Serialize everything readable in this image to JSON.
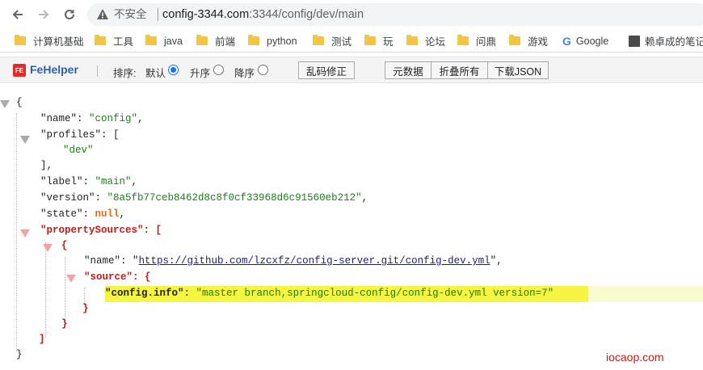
{
  "browser": {
    "insecure_label": "不安全",
    "url_host": "config-3344.com",
    "url_path": ":3344/config/dev/main"
  },
  "bookmarks": [
    {
      "label": "计算机基础",
      "icon": "folder-icon"
    },
    {
      "label": "工具",
      "icon": "folder-icon"
    },
    {
      "label": "java",
      "icon": "folder-icon"
    },
    {
      "label": "前端",
      "icon": "folder-icon"
    },
    {
      "label": "python",
      "icon": "folder-icon"
    },
    {
      "label": "测试",
      "icon": "folder-icon"
    },
    {
      "label": "玩",
      "icon": "folder-icon"
    },
    {
      "label": "论坛",
      "icon": "folder-icon"
    },
    {
      "label": "问鼎",
      "icon": "folder-icon"
    },
    {
      "label": "游戏",
      "icon": "folder-icon"
    },
    {
      "label": "Google",
      "icon": "google-icon"
    },
    {
      "label": "赖卓成的笔记",
      "icon": "image-icon"
    }
  ],
  "fehelper": {
    "title": "FeHelper",
    "logo": "FE",
    "sort_label": "排序:",
    "sort_options": [
      {
        "label": "默认",
        "checked": true
      },
      {
        "label": "升序",
        "checked": false
      },
      {
        "label": "降序",
        "checked": false
      }
    ],
    "fix_encoding": "乱码修正",
    "buttons": [
      "元数据",
      "折叠所有",
      "下载JSON"
    ]
  },
  "json": {
    "open_brace": "{",
    "close_brace": "}",
    "name_key": "\"name\"",
    "name_val": "\"config\"",
    "profiles_key": "\"profiles\"",
    "profiles_item": "\"dev\"",
    "label_key": "\"label\"",
    "label_val": "\"main\"",
    "version_key": "\"version\"",
    "version_val": "\"8a5fb77ceb8462d8c8f0cf33968d6c91560eb212\"",
    "state_key": "\"state\"",
    "state_val": "null",
    "ps_key": "\"propertySources\"",
    "ps_name_key": "\"name\"",
    "ps_name_val": "https://github.com/lzcxfz/config-server.git/config-dev.yml",
    "source_key": "\"source\"",
    "ci_key": "\"config.info\"",
    "ci_val": "\"master branch,springcloud-config/config-dev.yml version=7\""
  },
  "watermark": "iocaop.com",
  "colors": {
    "string": "#1a7f1a",
    "null": "#e46b0c",
    "highlight_key": "#c41a16",
    "selection": "#f5f542"
  }
}
